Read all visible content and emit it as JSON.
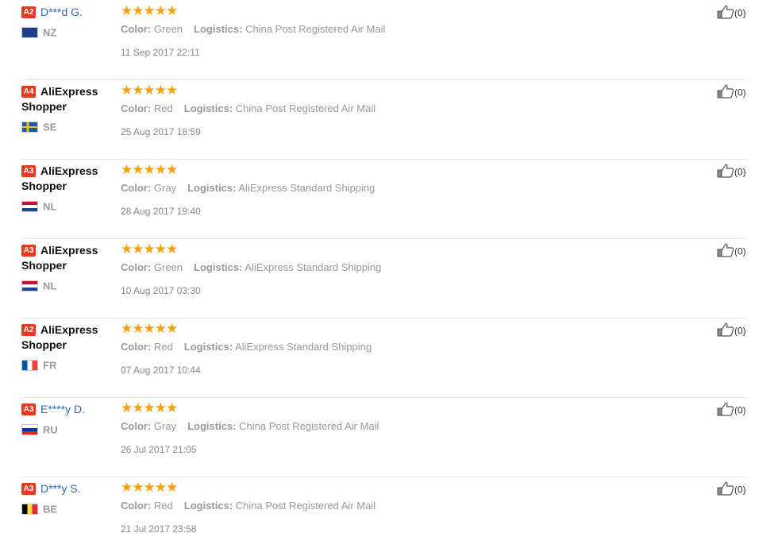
{
  "colors": {
    "star": "#f5a10d",
    "badge": "#e03b1e",
    "name_link": "#2a6bbd"
  },
  "labels": {
    "color": "Color:",
    "logistics": "Logistics:"
  },
  "reviews": [
    {
      "level": "A2",
      "name": "D***d G.",
      "name_style": "link",
      "country": "NZ",
      "flag": "nz-flag-icon",
      "rating": 5,
      "color": "Green",
      "logistics": "China Post Registered Air Mail",
      "date": "11 Sep 2017 22:11",
      "likes": "(0)"
    },
    {
      "level": "A4",
      "name": "AliExpress Shopper",
      "name_style": "plain",
      "country": "SE",
      "flag": "se-flag-icon",
      "rating": 5,
      "color": "Red",
      "logistics": "China Post Registered Air Mail",
      "date": "25 Aug 2017 18:59",
      "likes": "(0)"
    },
    {
      "level": "A3",
      "name": "AliExpress Shopper",
      "name_style": "plain",
      "country": "NL",
      "flag": "nl-flag-icon",
      "rating": 5,
      "color": "Gray",
      "logistics": "AliExpress Standard Shipping",
      "date": "28 Aug 2017 19:40",
      "likes": "(0)"
    },
    {
      "level": "A3",
      "name": "AliExpress Shopper",
      "name_style": "plain",
      "country": "NL",
      "flag": "nl-flag-icon",
      "rating": 5,
      "color": "Green",
      "logistics": "AliExpress Standard Shipping",
      "date": "10 Aug 2017 03:30",
      "likes": "(0)"
    },
    {
      "level": "A2",
      "name": "AliExpress Shopper",
      "name_style": "plain",
      "country": "FR",
      "flag": "fr-flag-icon",
      "rating": 5,
      "color": "Red",
      "logistics": "AliExpress Standard Shipping",
      "date": "07 Aug 2017 10:44",
      "likes": "(0)"
    },
    {
      "level": "A3",
      "name": "E****y D.",
      "name_style": "link",
      "country": "RU",
      "flag": "ru-flag-icon",
      "rating": 5,
      "color": "Gray",
      "logistics": "China Post Registered Air Mail",
      "date": "26 Jul 2017 21:05",
      "likes": "(0)"
    },
    {
      "level": "A3",
      "name": "D***y S.",
      "name_style": "link",
      "country": "BE",
      "flag": "be-flag-icon",
      "rating": 5,
      "color": "Red",
      "logistics": "China Post Registered Air Mail",
      "date": "21 Jul 2017 23:58",
      "likes": "(0)"
    }
  ]
}
